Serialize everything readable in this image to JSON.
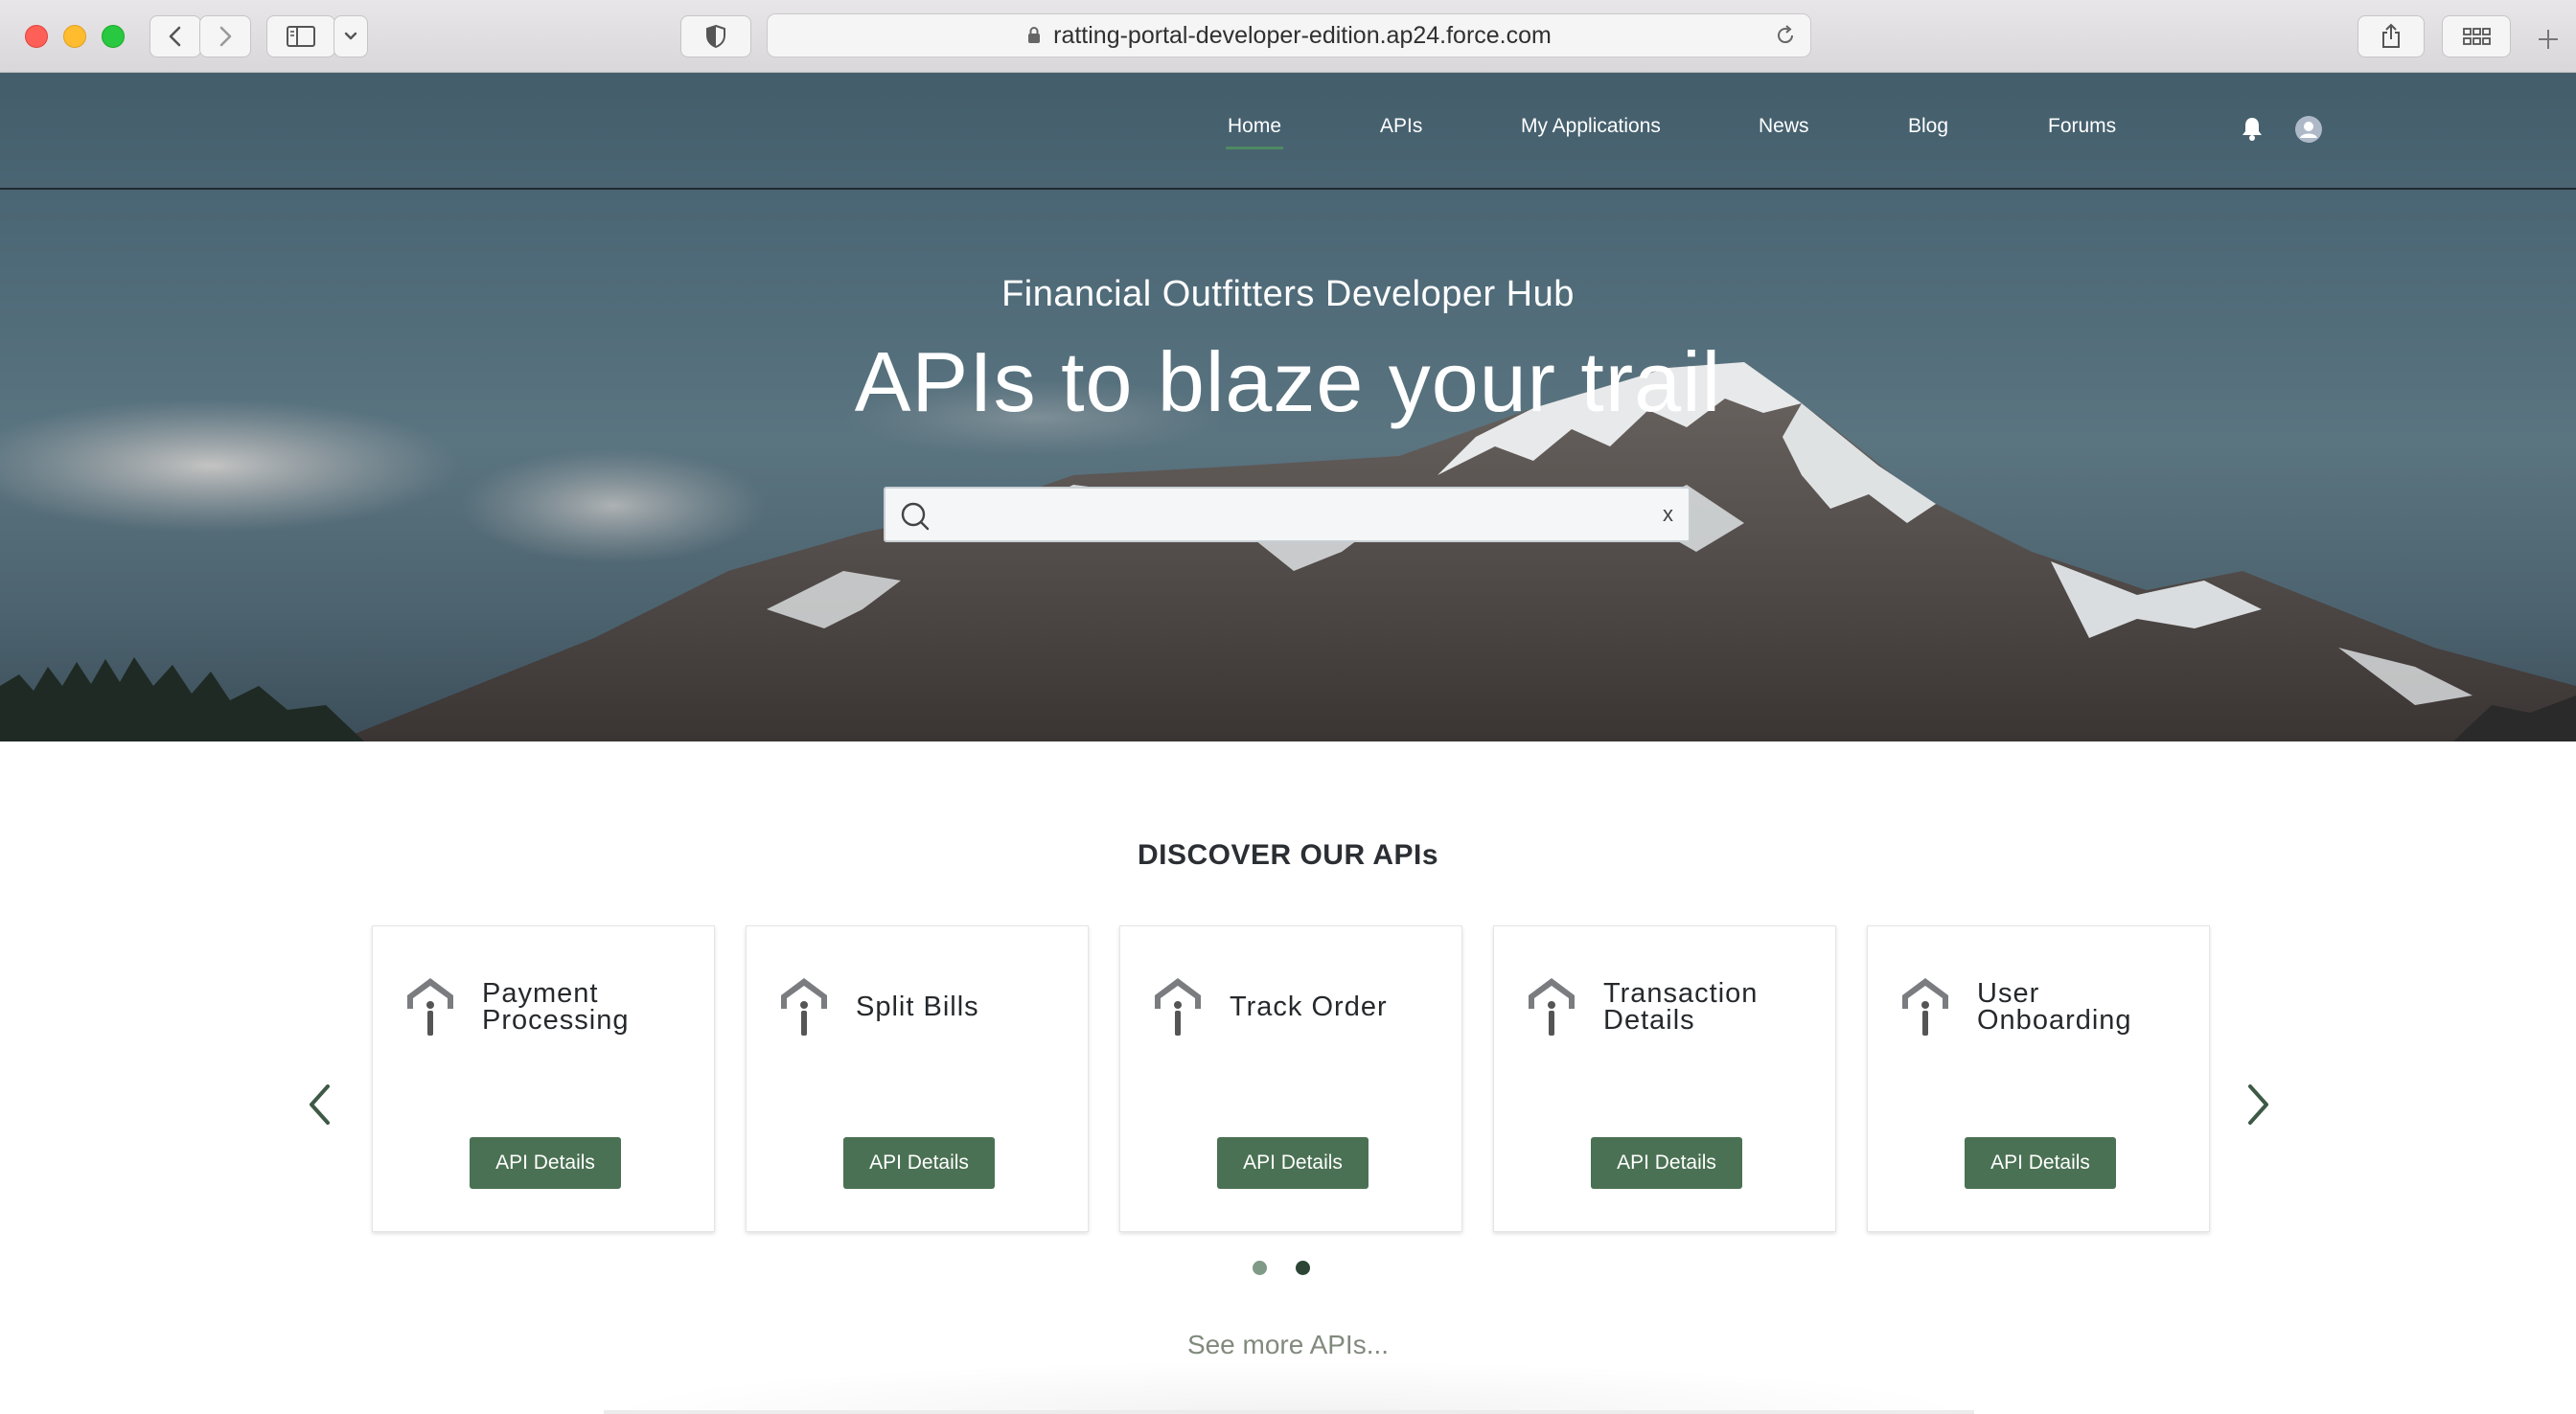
{
  "browser": {
    "url": "ratting-portal-developer-edition.ap24.force.com",
    "icons": [
      "back-icon",
      "forward-icon",
      "sidebar-icon",
      "chevron-down-icon",
      "shield-icon",
      "lock-icon",
      "reload-icon",
      "share-icon",
      "tab-overview-icon",
      "new-tab-icon"
    ]
  },
  "nav": {
    "items": [
      {
        "label": "Home",
        "active": true
      },
      {
        "label": "APIs"
      },
      {
        "label": "My Applications"
      },
      {
        "label": "News"
      },
      {
        "label": "Blog"
      },
      {
        "label": "Forums"
      }
    ],
    "icons": [
      "bell-icon",
      "user-avatar-icon"
    ]
  },
  "hero": {
    "subtitle": "Financial Outfitters Developer Hub",
    "title": "APIs to blaze your trail",
    "search": {
      "placeholder": "",
      "value": "",
      "clear_label": "x"
    }
  },
  "discover": {
    "title": "DISCOVER OUR APIs",
    "cards": [
      {
        "name": "Payment Processing",
        "button": "API Details"
      },
      {
        "name": "Split Bills",
        "button": "API Details"
      },
      {
        "name": "Track Order",
        "button": "API Details"
      },
      {
        "name": "Transaction Details",
        "button": "API Details"
      },
      {
        "name": "User Onboarding",
        "button": "API Details"
      }
    ],
    "pagination": {
      "pages": 2,
      "current": 2
    },
    "see_more": "See more APIs..."
  },
  "colors": {
    "accent": "#4a7153",
    "nav_underline": "#4d8a62",
    "heading": "#2b2f33"
  }
}
